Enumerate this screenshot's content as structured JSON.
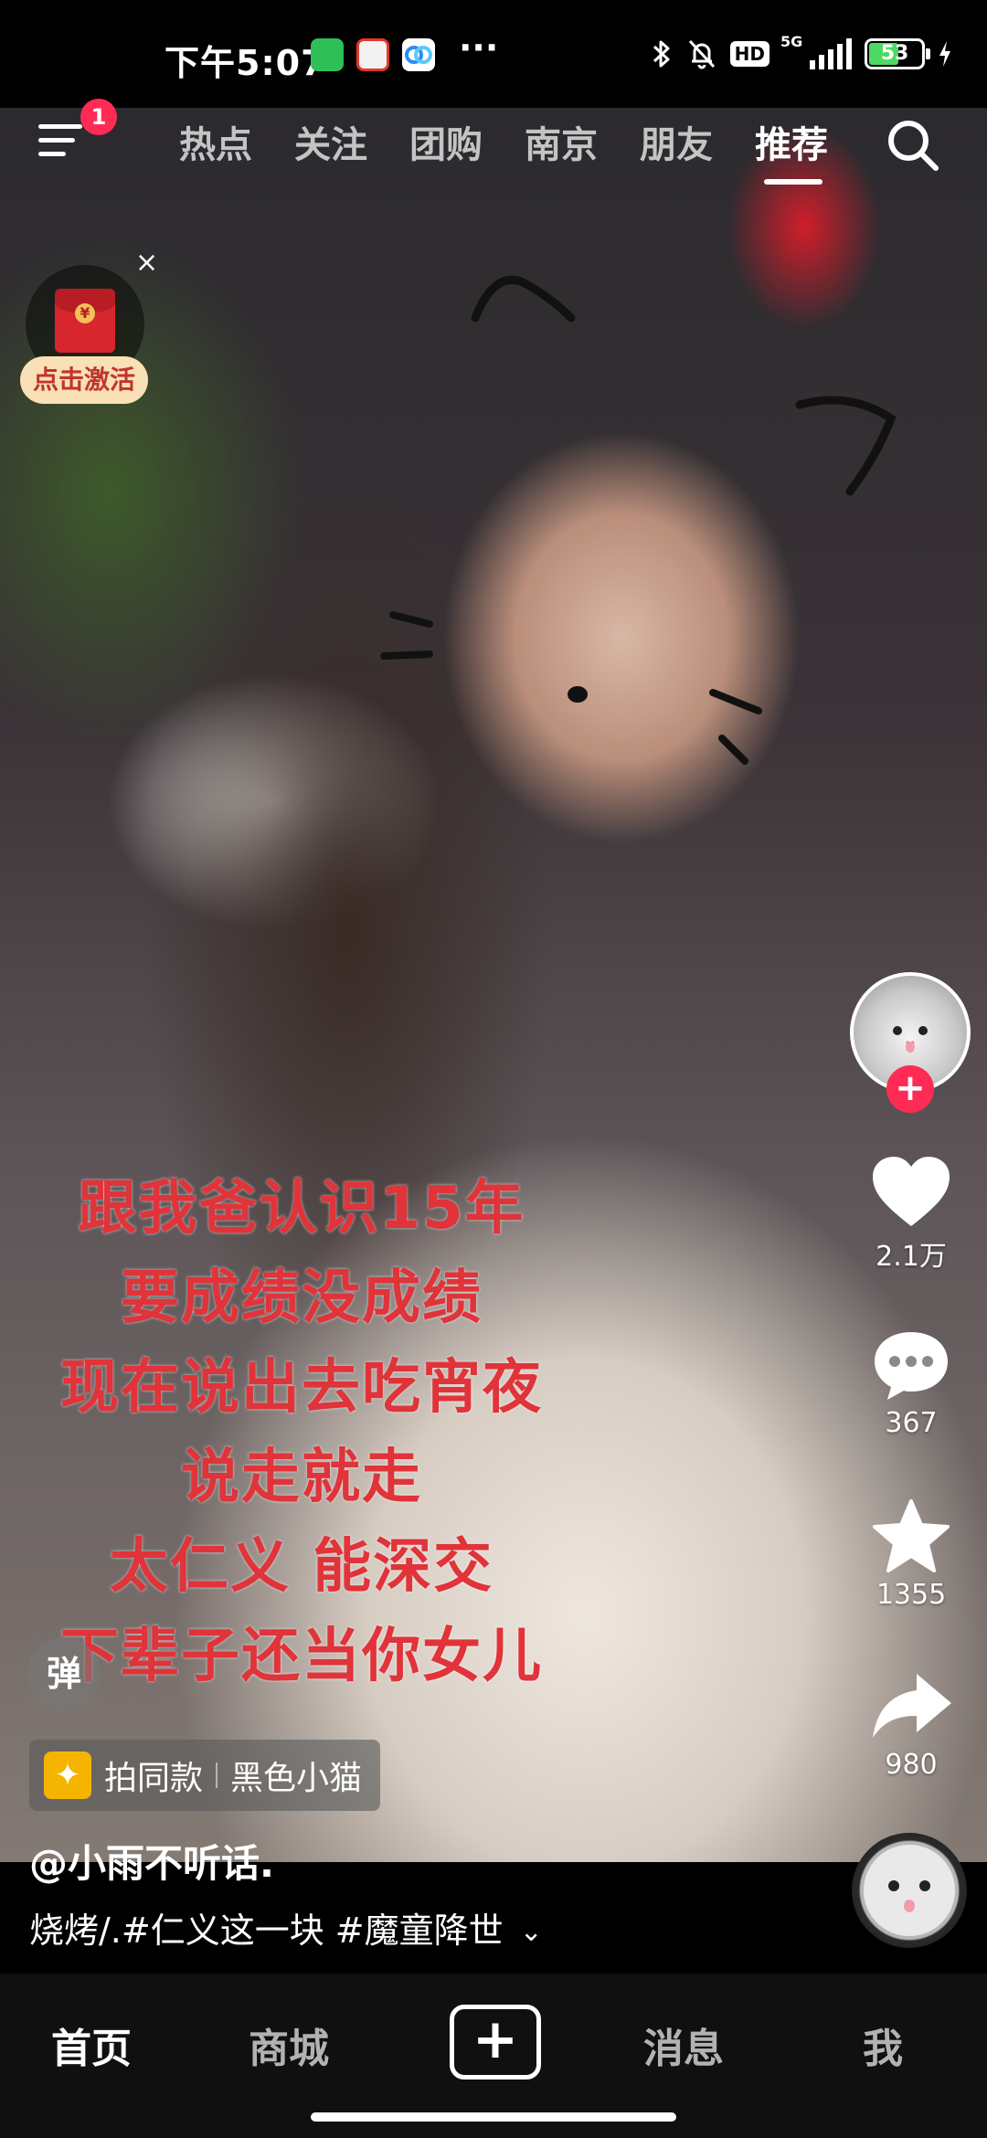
{
  "status_bar": {
    "time": "下午5:07",
    "network": "5G",
    "hd": "HD",
    "battery": "53",
    "more": "···",
    "app_icons": [
      "wechat-icon",
      "58-app-icon",
      "baidu-netdisk-icon"
    ]
  },
  "top_nav": {
    "notification_count": "1",
    "tabs": [
      {
        "label": "热点"
      },
      {
        "label": "关注"
      },
      {
        "label": "团购"
      },
      {
        "label": "南京"
      },
      {
        "label": "朋友"
      },
      {
        "label": "推荐"
      }
    ],
    "active_tab": "推荐"
  },
  "red_packet": {
    "label": "点击激活",
    "close": "×"
  },
  "video_subtitles": [
    "跟我爸认识15年",
    "要成绩没成绩",
    "现在说出去吃宵夜",
    "说走就走",
    "太仁义 能深交",
    "下辈子还当你女儿"
  ],
  "actions": {
    "follow": "+",
    "likes": "2.1万",
    "comments": "367",
    "favorites": "1355",
    "shares": "980"
  },
  "video_info": {
    "danmaku": "弹",
    "template_label": "拍同款",
    "template_name": "黑色小猫",
    "author": "@小雨不听话.",
    "caption": "烧烤/.#仁义这一块 #魔童降世",
    "expand": "⌄"
  },
  "bottom_nav": {
    "home": "首页",
    "mall": "商城",
    "create": "+",
    "messages": "消息",
    "me": "我"
  },
  "colors": {
    "accent": "#fe2c55",
    "subtitle": "#e0333a",
    "battery_fill": "#4cd964"
  }
}
